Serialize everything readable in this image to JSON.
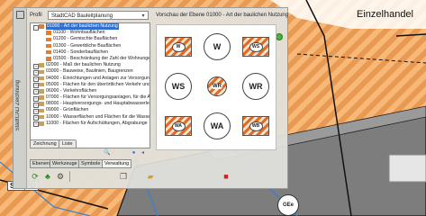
{
  "map": {
    "label_einzelhandel": "Einzelhandel",
    "label_stp": "STP|PD",
    "label_gee": "GEe",
    "colors": {
      "orange_hatch": "#e89a52",
      "gray_area": "#7d7d7d",
      "blue_line": "#3b7fd0"
    }
  },
  "panel": {
    "side_label": "StadtCAD Zeichnung",
    "profil_label": "Profil",
    "profil_value": "StadtCAD Bauleitplanung",
    "vorschau_label": "Vorschau der Ebene 01000 - Art der baulichen Nutzung",
    "tree": [
      {
        "label": "01000 - Art der baulichen Nutzung",
        "depth": 0,
        "expander": "-",
        "swatch": "#e07c33",
        "selected": true
      },
      {
        "label": "01100 - Wohnbauflächen",
        "depth": 1,
        "expander": "",
        "swatch": "#e07c33",
        "selected": false
      },
      {
        "label": "01200 - Gemischte Bauflächen",
        "depth": 1,
        "expander": "",
        "swatch": "#e07c33",
        "selected": false
      },
      {
        "label": "01300 - Gewerbliche Bauflächen",
        "depth": 1,
        "expander": "",
        "swatch": "#e07c33",
        "selected": false
      },
      {
        "label": "01400 - Sonderbauflächen",
        "depth": 1,
        "expander": "",
        "swatch": "#e07c33",
        "selected": false
      },
      {
        "label": "01500 - Beschränkung der Zahl der Wohnungen",
        "depth": 1,
        "expander": "",
        "swatch": "#e07c33",
        "selected": false
      },
      {
        "label": "02000 - Maß der baulichen Nutzung",
        "depth": 0,
        "expander": "+",
        "swatch": "#c9a060",
        "selected": false
      },
      {
        "label": "03000 - Bauweise, Baulinien, Baugrenzen",
        "depth": 0,
        "expander": "+",
        "swatch": "#c9a060",
        "selected": false
      },
      {
        "label": "04000 - Einrichtungen und Anlagen zur Versorgung",
        "depth": 0,
        "expander": "+",
        "swatch": "#c9a060",
        "selected": false
      },
      {
        "label": "05000 - Flächen für den überörtlichen Verkehr und",
        "depth": 0,
        "expander": "+",
        "swatch": "#c9a060",
        "selected": false
      },
      {
        "label": "06000 - Verkehrsflächen",
        "depth": 0,
        "expander": "+",
        "swatch": "#c9a060",
        "selected": false
      },
      {
        "label": "07000 - Flächen für Versorgungsanlagen, für die A",
        "depth": 0,
        "expander": "+",
        "swatch": "#c9a060",
        "selected": false
      },
      {
        "label": "08000 - Hauptversorgungs- und Hauptabwasserleit",
        "depth": 0,
        "expander": "+",
        "swatch": "#c9a060",
        "selected": false
      },
      {
        "label": "09000 - Grünflächen",
        "depth": 0,
        "expander": "+",
        "swatch": "#c9a060",
        "selected": false
      },
      {
        "label": "10000 - Wasserflächen und Flächen für die Wasse",
        "depth": 0,
        "expander": "+",
        "swatch": "#c9a060",
        "selected": false
      },
      {
        "label": "11000 - Flächen für Aufschüttungen, Abgrabunge",
        "depth": 0,
        "expander": "+",
        "swatch": "#c9a060",
        "selected": false
      }
    ],
    "preview_symbols": [
      {
        "kind": "box",
        "text": "W"
      },
      {
        "kind": "circle",
        "text": "W"
      },
      {
        "kind": "box",
        "text": "WS"
      },
      {
        "kind": "circle",
        "text": "WS"
      },
      {
        "kind": "circle-hatch",
        "text": "WR"
      },
      {
        "kind": "circle",
        "text": "WR"
      },
      {
        "kind": "box",
        "text": "WA"
      },
      {
        "kind": "circle",
        "text": "WA"
      },
      {
        "kind": "box",
        "text": "WB"
      }
    ],
    "lower_tabs": [
      "Zeichnung",
      "Liste"
    ],
    "bottom_tabs": [
      "Ebenen",
      "Werkzeuge",
      "Symbole",
      "Verwaltung"
    ],
    "active_bottom_tab": "Verwaltung"
  }
}
